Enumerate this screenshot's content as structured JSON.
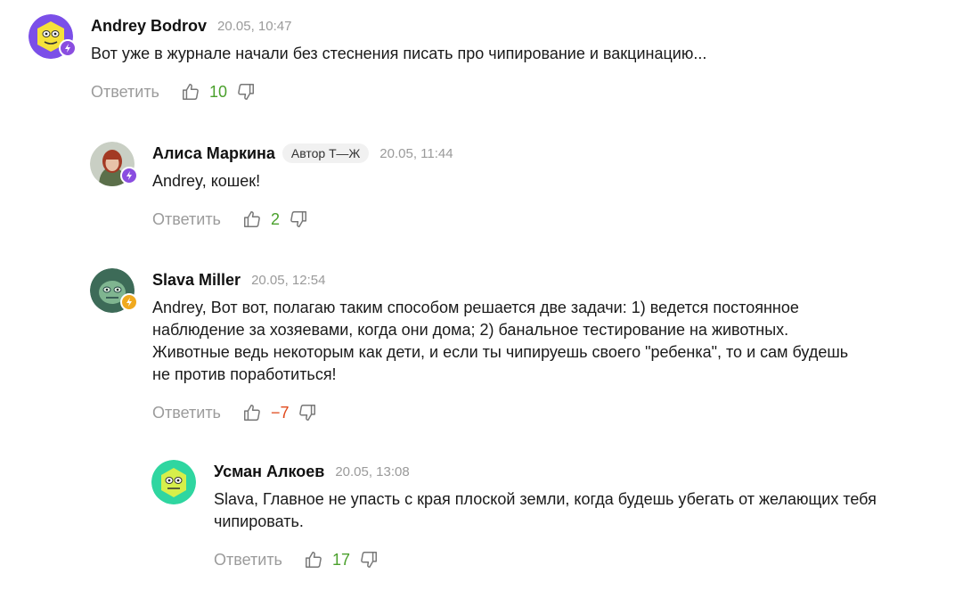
{
  "colors": {
    "positive": "#4aa02c",
    "negative": "#e0491b",
    "muted": "#9b9b9b",
    "author_tag_bg": "#f1f1f1"
  },
  "reply_label": "Ответить",
  "comments": [
    {
      "author": "Andrey Bodrov",
      "time": "20.05, 10:47",
      "text": "Вот уже в журнале начали без стеснения писать про чипирование и вакцинацию...",
      "likes": "10",
      "avatar_icon": "yellow-face-avatar",
      "badge_icon": "plus-bolt-badge"
    },
    {
      "author": "Алиса Маркина",
      "author_tag": "Автор Т—Ж",
      "time": "20.05, 11:44",
      "text": "Andrey, кошек!",
      "likes": "2",
      "avatar_icon": "photo-avatar",
      "badge_icon": "plus-bolt-badge"
    },
    {
      "author": "Slava Miller",
      "time": "20.05, 12:54",
      "text_lines": [
        "Andrey, Вот вот, полагаю таким способом решается две задачи: 1) ведется постоянное",
        "наблюдение за хозяевами, когда они дома; 2) банальное тестирование на животных.",
        "Животные ведь некоторым как дети, и если ты чипируешь своего \"ребенка\", то и сам будешь",
        "не против поработиться!"
      ],
      "likes": "−7",
      "avatar_icon": "green-face-avatar",
      "badge_icon": "bolt-badge"
    },
    {
      "author": "Усман Алкоев",
      "time": "20.05, 13:08",
      "text_lines": [
        "Slava, Главное не упасть с края плоской земли, когда будешь убегать от желающих тебя",
        "чипировать."
      ],
      "likes": "17",
      "avatar_icon": "mint-face-avatar"
    }
  ]
}
